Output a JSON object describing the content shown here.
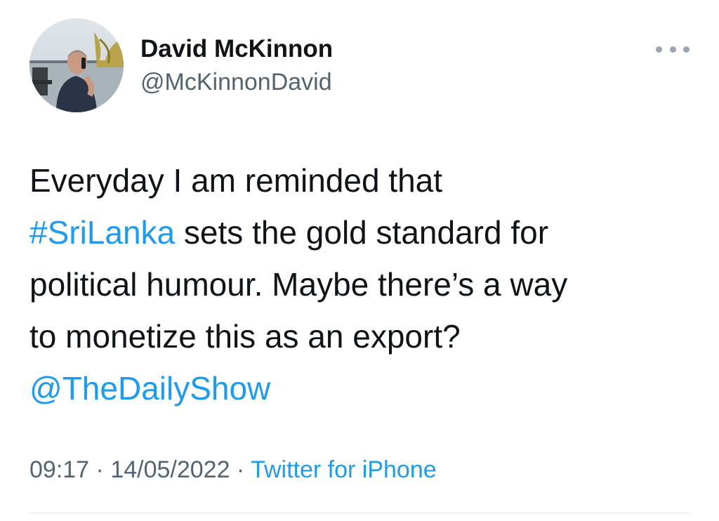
{
  "tweet": {
    "author": {
      "name": "David McKinnon",
      "handle": "@McKinnonDavid"
    },
    "text": {
      "line1": "Everyday I am reminded that",
      "hashtag": "#SriLanka",
      "line2_rest": " sets the gold standard for",
      "line3": "political humour. Maybe there’s a way",
      "line4": "to monetize this as an export?",
      "mention": "@TheDailyShow"
    },
    "meta": {
      "time": "09:17",
      "separator": " · ",
      "date": "14/05/2022",
      "source": "Twitter for iPhone"
    },
    "more_icon": "more-horizontal-icon",
    "colors": {
      "link": "#1d9bf0",
      "secondary": "#536471",
      "text": "#0f1419"
    }
  }
}
